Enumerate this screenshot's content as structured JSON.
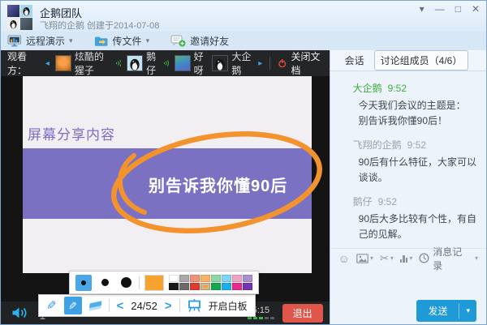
{
  "window": {
    "title": "企鹅团队",
    "subtitle": "飞翔的企鹅 创建于2014-07-08",
    "controls": {
      "menu": "▾",
      "minimize": "—",
      "maximize": "□",
      "close": "✕"
    }
  },
  "toolbar": {
    "remote_demo": "远程演示",
    "send_file": "传文件",
    "invite": "邀请好友"
  },
  "glyphs": {
    "caret_down": "▾",
    "scroll_left": "◂",
    "scroll_right": "▸",
    "prev": "<",
    "next": ">",
    "smiley": "☺",
    "scissors": "✂",
    "pencil": "✎"
  },
  "viewer_bar": {
    "label": "观看方：",
    "viewers": [
      {
        "name": "炫酷的猩子",
        "speaking": true
      },
      {
        "name": "鹅仔",
        "speaking": true
      },
      {
        "name": "好呀",
        "speaking": false
      },
      {
        "name": "大企鹅",
        "speaking": false
      }
    ],
    "close_doc": "关闭文档"
  },
  "slide": {
    "heading": "屏幕分享内容",
    "banner_text": "别告诉我你懂90后",
    "banner_color": "#7b71c3",
    "annotation_color": "#f2932e"
  },
  "pen_toolbar": {
    "page": "24/52",
    "whiteboard": "开启白板"
  },
  "palette": {
    "current_color": "#f5a22e",
    "row1": [
      "#ffffff",
      "#a9a9a9",
      "#f19078",
      "#f7b36b",
      "#8fd6a3",
      "#7ed3f7",
      "#f1a3c6",
      "#a78fd0"
    ],
    "row2": [
      "#1a1a1a",
      "#6b6b6b",
      "#e03b2f",
      "#f5a22e",
      "#13a84e",
      "#1caeea",
      "#e8298f",
      "#7633b9"
    ],
    "selected": "#f5a22e"
  },
  "bottom_bar": {
    "timer": "25:15",
    "exit": "退出",
    "signal_bars": {
      "active": 3,
      "total": 5
    }
  },
  "chat": {
    "tabs": [
      {
        "label": "会话"
      },
      {
        "label": "讨论组成员（4/6）"
      }
    ],
    "messages": [
      {
        "sender": "大企鹅",
        "time": "9:52",
        "name_color": "#3eae3b",
        "lines": [
          "今天我们会议的主题是：",
          "别告诉我你懂90后！"
        ]
      },
      {
        "sender": "飞翔的企鹅",
        "time": "9:52",
        "name_color": "#9aa4ad",
        "lines": [
          "90后有什么特征，大家可以谈谈。"
        ]
      },
      {
        "sender": "鹅仔",
        "time": "9:52",
        "name_color": "#9aa4ad",
        "lines": [
          "90后大多比较有个性，有自己的见解。"
        ]
      }
    ],
    "history_label": "消息记录",
    "send_label": "发送"
  }
}
